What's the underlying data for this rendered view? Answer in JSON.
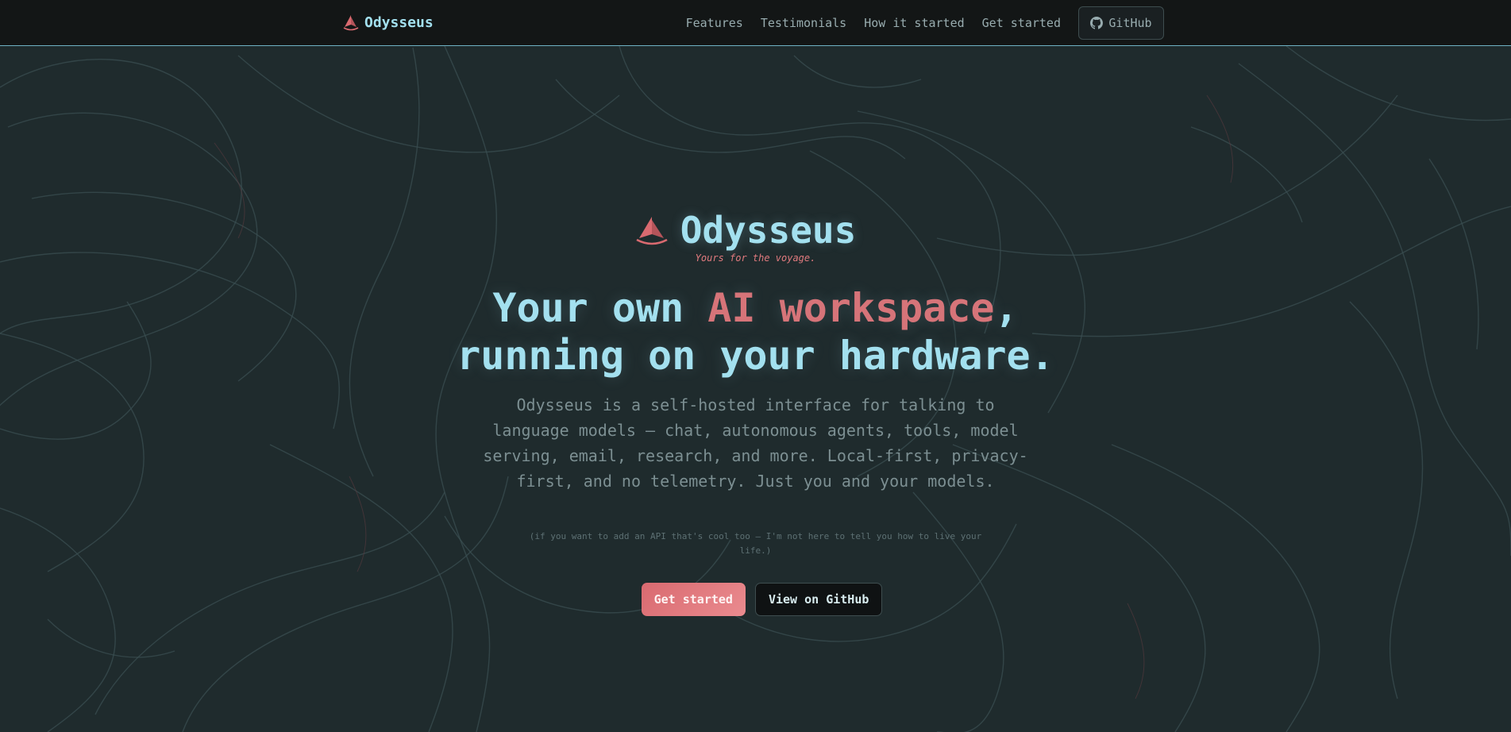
{
  "colors": {
    "background": "#1f2b2d",
    "navbar": "#131616",
    "brand_cyan": "#a3e0ef",
    "accent_coral": "#d67479",
    "muted_text": "#7c8f92",
    "nav_border": "#6fb2c4"
  },
  "nav": {
    "brand": {
      "icon": "sail-logo-icon",
      "name": "Odysseus"
    },
    "links": [
      "Features",
      "Testimonials",
      "How it started",
      "Get started"
    ],
    "github_button": {
      "icon": "github-icon",
      "label": "GitHub"
    }
  },
  "hero": {
    "logo_icon": "sail-logo-icon",
    "name": "Odysseus",
    "tagline": "Yours for the voyage.",
    "headline": {
      "line1_start": "Your own ",
      "line1_accent": "AI workspace",
      "line1_end": ",",
      "line2": "running on your hardware."
    },
    "description": "Odysseus is a self-hosted interface for talking to language models — chat, autonomous agents, tools, model serving, email, research, and more. Local-first, privacy-first, and no telemetry. Just you and your models.",
    "aside_note": "(if you want to add an API that's cool too — I'm not here to tell you how to live your life.)",
    "primary_cta": "Get started",
    "secondary_cta": "View on GitHub"
  }
}
